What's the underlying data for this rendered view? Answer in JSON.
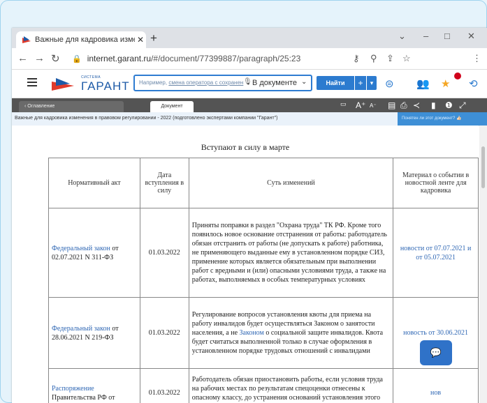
{
  "browser": {
    "tab_title": "Важные для кадровика изменен",
    "tab_close": "✕",
    "new_tab": "+",
    "url_host": "internet.garant.ru",
    "url_path": "/#/document/77399887/paragraph/25:23",
    "window_controls": [
      "⌄",
      "–",
      "□",
      "✕"
    ],
    "menu": "⋮"
  },
  "garant": {
    "logo_system": "СИСТЕМА",
    "logo_name": "ГАРАНТ",
    "search_placeholder_prefix": "Например, ",
    "search_placeholder_link": "смена оператора с сохранен",
    "search_scope": "В документе",
    "find_label": "Найти",
    "find_plus": "+",
    "find_arrow": "▾"
  },
  "docbar": {
    "tab_contents": "Оглавление",
    "tab_document": "Документ",
    "font_big": "A⁺",
    "font_small": "A⁻"
  },
  "subheader": {
    "breadcrumb": "Важные для кадровика изменения в правовом регулировании - 2022 (подготовлено экспертами компании \"Гарант\")",
    "ask_button": "Понятен ли этот документ?"
  },
  "content": {
    "section_title": "Вступают в силу в марте",
    "columns": [
      "Нормативный акт",
      "Дата вступления в силу",
      "Суть изменений",
      "Материал о событии в новостной ленте для кадровика"
    ],
    "rows": [
      {
        "act_link": "Федеральный закон",
        "act_rest": " от 02.07.2021 N 311-ФЗ",
        "date": "01.03.2022",
        "essence_before": "Приняты поправки в раздел \"Охрана труда\" ТК РФ. Кроме того появилось новое основание отстранения от работы: работодатель обязан отстранить от работы (не допускать к работе) работника, не применяющего выданные ему в установленном порядке СИЗ, применение которых является обязательным при выполнении работ с вредными и (или) опасными условиями труда, а также на работах, выполняемых в особых температурных условиях",
        "essence_link": "",
        "essence_after": "",
        "material": "новости от 07.07.2021 и от 05.07.2021"
      },
      {
        "act_link": "Федеральный закон",
        "act_rest": " от 28.06.2021 N 219-ФЗ",
        "date": "01.03.2022",
        "essence_before": "Регулирование вопросов установления квоты для приема на работу инвалидов будет осуществляться Законом о занятости населения, а не ",
        "essence_link": "Законом",
        "essence_after": " о социальной защите инвалидов. Квота будет считаться выполненной только в случае оформления в установленном порядке трудовых отношений с инвалидами",
        "material": "новость от 30.06.2021"
      },
      {
        "act_link": "Распоряжение",
        "act_rest": " Правительства РФ от",
        "date": "01.03.2022",
        "essence_before": "Работодатель обязан приостановить работы, если условия труда на рабочих местах по результатам спецоценки отнесены к опасному классу, до устранения оснований установления этого класса. Правительство",
        "essence_link": "",
        "essence_after": "",
        "material": "нов"
      }
    ]
  },
  "colors": {
    "accent": "#2c7bcf",
    "link": "#2f67b4",
    "dark_bar": "#545454",
    "badge": "#d0021b"
  }
}
